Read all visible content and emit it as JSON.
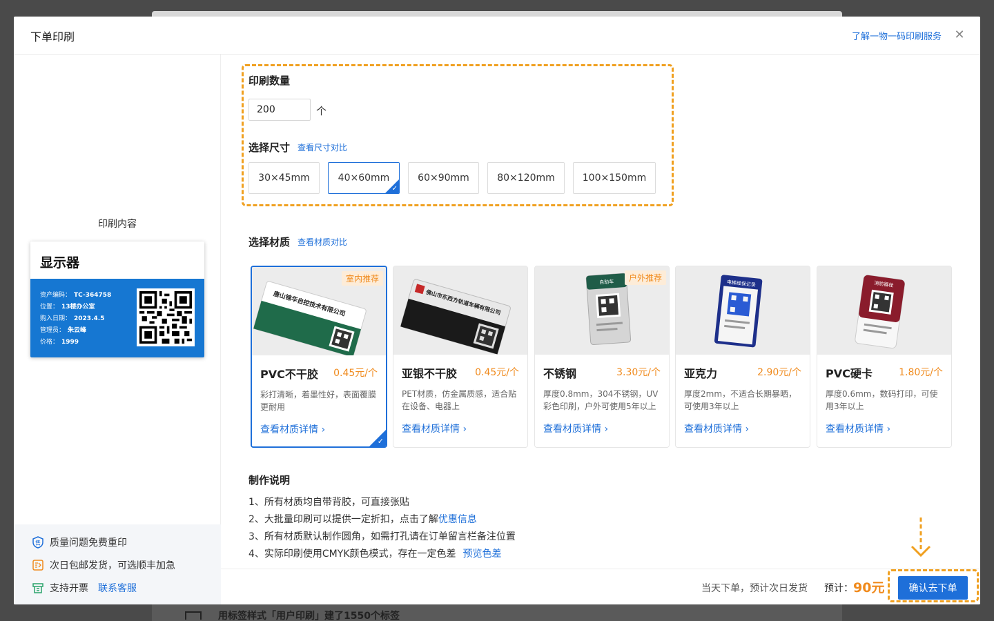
{
  "modal": {
    "title": "下单印刷",
    "header_link": "了解一物一码印刷服务",
    "close_icon": "close-icon"
  },
  "preview": {
    "label": "印刷内容",
    "card_title": "显示器",
    "fields": [
      {
        "key": "资产编码：",
        "value": "TC-364758"
      },
      {
        "key": "位置：",
        "value": "13楼办公室"
      },
      {
        "key": "购入日期：",
        "value": "2023.4.5"
      },
      {
        "key": "管理员：",
        "value": "朱云峰"
      },
      {
        "key": "价格：",
        "value": "1999"
      }
    ]
  },
  "left_footer": {
    "items": [
      {
        "text": "质量问题免费重印",
        "icon": "shield-icon"
      },
      {
        "text": "次日包邮发货，可选顺丰加急",
        "icon": "delivery-icon"
      },
      {
        "text": "支持开票",
        "icon": "invoice-icon",
        "link": "联系客服"
      }
    ]
  },
  "quantity": {
    "title": "印刷数量",
    "value": "200",
    "unit": "个"
  },
  "size": {
    "title": "选择尺寸",
    "compare_link": "查看尺寸对比",
    "options": [
      "30×45mm",
      "40×60mm",
      "60×90mm",
      "80×120mm",
      "100×150mm"
    ],
    "selected": "40×60mm"
  },
  "material": {
    "title": "选择材质",
    "compare_link": "查看材质对比",
    "items": [
      {
        "name": "PVC不干胶",
        "price": "0.45元/个",
        "desc": "彩打清晰，着墨性好，表面覆膜更耐用",
        "link": "查看材质详情",
        "badge": "室内推荐",
        "selected": true
      },
      {
        "name": "亚银不干胶",
        "price": "0.45元/个",
        "desc": "PET材质，仿金属质感，适合贴在设备、电器上",
        "link": "查看材质详情",
        "badge": ""
      },
      {
        "name": "不锈钢",
        "price": "3.30元/个",
        "desc": "厚度0.8mm，304不锈钢，UV彩色印刷，户外可使用5年以上",
        "link": "查看材质详情",
        "badge": "户外推荐"
      },
      {
        "name": "亚克力",
        "price": "2.90元/个",
        "desc": "厚度2mm，不适合长期暴晒，可使用3年以上",
        "link": "查看材质详情",
        "badge": ""
      },
      {
        "name": "PVC硬卡",
        "price": "1.80元/个",
        "desc": "厚度0.6mm，数码打印，可使用3年以上",
        "link": "查看材质详情",
        "badge": ""
      }
    ],
    "sample_texts": {
      "green": "唐山锦华自控技术有限公司",
      "silver": "佛山市东西方轨道车辆有限公司",
      "steel": "自助车",
      "acrylic": "电梯维保记录",
      "card": "消防器栓"
    }
  },
  "notes": {
    "title": "制作说明",
    "n1": "1、所有材质均自带背胶，可直接张贴",
    "n2_prefix": "2、大批量印刷可以提供一定折扣，点击了解",
    "n2_link": "优惠信息",
    "n3": "3、所有材质默认制作圆角，如需打孔请在订单留言栏备注位置",
    "n4_prefix": "4、实际印刷使用CMYK颜色模式，存在一定色差",
    "n4_link": "预览色差"
  },
  "footer": {
    "ship_text": "当天下单，预计次日发货",
    "est_label": "预计：",
    "est_price": "90元",
    "confirm": "确认去下单"
  },
  "background": {
    "behind_text": "用标签样式「用户印刷」建了1550个标签"
  },
  "colors": {
    "accent": "#1e6fd9",
    "orange": "#f08a1c",
    "annotation": "#f0a020"
  }
}
